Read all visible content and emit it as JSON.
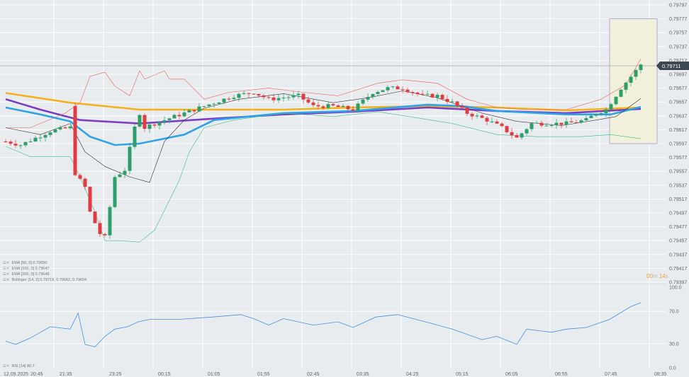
{
  "legend": [
    {
      "label": "EMA [50, 0] 0.79650"
    },
    {
      "label": "EMA [100, 0] 0.79647"
    },
    {
      "label": "EMA [200, 0] 0.79649"
    },
    {
      "label": "Bollinger [14, 2] 0.79719, 0.79662, 0.79604"
    }
  ],
  "rsi_legend": "RSI [14] 80.7",
  "current_price": "0.79711",
  "timer": {
    "min": "00",
    "min_unit": "m",
    "sec": "14",
    "sec_unit": "s"
  },
  "colors": {
    "up": "#2e9e6a",
    "down": "#e23b3f",
    "ema50": "#2ea3e6",
    "ema100": "#7b3fc4",
    "ema200": "#f2b31c",
    "bb_upper": "#e8625f",
    "bb_mid": "#333333",
    "bb_lower": "#3fbf85",
    "rsi": "#4a90e2",
    "highlight": "#f0f0dc"
  },
  "chart_data": {
    "type": "candlestick",
    "price_axis": {
      "ticks": [
        "0.79797",
        "0.79777",
        "0.79757",
        "0.79737",
        "0.79717",
        "0.79697",
        "0.79677",
        "0.79657",
        "0.79637",
        "0.79617",
        "0.79597",
        "0.79577",
        "0.79557",
        "0.79537",
        "0.79517",
        "0.79497",
        "0.79477",
        "0.79457",
        "0.79437",
        "0.79417",
        "0.79397"
      ],
      "range": [
        0.79397,
        0.79797
      ]
    },
    "time_axis": [
      "12.09.2025",
      "20:45",
      "21:35",
      "23:25",
      "00:15",
      "01:05",
      "01:55",
      "02:45",
      "03:35",
      "04:25",
      "05:15",
      "06:05",
      "06:55",
      "07:45",
      "08:35"
    ],
    "candle_count": 129,
    "close_keypoints": [
      [
        0,
        0.796
      ],
      [
        3,
        0.79595
      ],
      [
        6,
        0.79605
      ],
      [
        9,
        0.79615
      ],
      [
        13,
        0.7962
      ],
      [
        14,
        0.79554
      ],
      [
        16,
        0.79534
      ],
      [
        17,
        0.79498
      ],
      [
        19,
        0.79467
      ],
      [
        20,
        0.79462
      ],
      [
        22,
        0.79549
      ],
      [
        24,
        0.79559
      ],
      [
        26,
        0.7962
      ],
      [
        27,
        0.79641
      ],
      [
        28,
        0.7962
      ],
      [
        30,
        0.79626
      ],
      [
        36,
        0.79641
      ],
      [
        40,
        0.79651
      ],
      [
        46,
        0.79666
      ],
      [
        50,
        0.79671
      ],
      [
        53,
        0.79661
      ],
      [
        59,
        0.79666
      ],
      [
        62,
        0.79651
      ],
      [
        66,
        0.79651
      ],
      [
        70,
        0.79646
      ],
      [
        74,
        0.79671
      ],
      [
        77,
        0.79677
      ],
      [
        80,
        0.79677
      ],
      [
        84,
        0.79666
      ],
      [
        87,
        0.79666
      ],
      [
        90,
        0.79656
      ],
      [
        93,
        0.79641
      ],
      [
        97,
        0.79631
      ],
      [
        100,
        0.7962
      ],
      [
        103,
        0.79605
      ],
      [
        106,
        0.79626
      ],
      [
        109,
        0.79626
      ],
      [
        113,
        0.79626
      ],
      [
        117,
        0.79631
      ],
      [
        119,
        0.79641
      ],
      [
        121,
        0.79646
      ],
      [
        124,
        0.79677
      ],
      [
        127,
        0.79702
      ],
      [
        128,
        0.79711
      ]
    ],
    "series": [
      {
        "name": "EMA 200",
        "color_key": "ema200",
        "points": [
          [
            0,
            0.7967
          ],
          [
            13,
            0.79656
          ],
          [
            27,
            0.79646
          ],
          [
            56,
            0.79646
          ],
          [
            70,
            0.79649
          ],
          [
            85,
            0.79651
          ],
          [
            99,
            0.79649
          ],
          [
            113,
            0.79645
          ],
          [
            128,
            0.79649
          ]
        ]
      },
      {
        "name": "EMA 100",
        "color_key": "ema100",
        "points": [
          [
            0,
            0.79661
          ],
          [
            7,
            0.79646
          ],
          [
            15,
            0.79631
          ],
          [
            27,
            0.79626
          ],
          [
            42,
            0.79633
          ],
          [
            56,
            0.79639
          ],
          [
            70,
            0.79643
          ],
          [
            85,
            0.79649
          ],
          [
            99,
            0.79644
          ],
          [
            113,
            0.79641
          ],
          [
            128,
            0.79647
          ]
        ]
      },
      {
        "name": "EMA 50",
        "color_key": "ema50",
        "points": [
          [
            0,
            0.79649
          ],
          [
            7,
            0.79639
          ],
          [
            13,
            0.79629
          ],
          [
            17,
            0.79607
          ],
          [
            22,
            0.79595
          ],
          [
            27,
            0.79597
          ],
          [
            36,
            0.7961
          ],
          [
            42,
            0.79631
          ],
          [
            56,
            0.79641
          ],
          [
            70,
            0.79644
          ],
          [
            85,
            0.79653
          ],
          [
            92,
            0.79651
          ],
          [
            99,
            0.79644
          ],
          [
            113,
            0.79639
          ],
          [
            122,
            0.79639
          ],
          [
            128,
            0.7965
          ]
        ]
      },
      {
        "name": "Bollinger upper",
        "color_key": "bb_upper",
        "points": [
          [
            0,
            0.7962
          ],
          [
            5,
            0.7962
          ],
          [
            12,
            0.79641
          ],
          [
            15,
            0.79656
          ],
          [
            17,
            0.79694
          ],
          [
            20,
            0.797
          ],
          [
            22,
            0.7968
          ],
          [
            25,
            0.79666
          ],
          [
            27,
            0.79702
          ],
          [
            28,
            0.7969
          ],
          [
            32,
            0.79702
          ],
          [
            33,
            0.7969
          ],
          [
            36,
            0.7969
          ],
          [
            40,
            0.79661
          ],
          [
            45,
            0.79671
          ],
          [
            53,
            0.79677
          ],
          [
            60,
            0.79671
          ],
          [
            67,
            0.79666
          ],
          [
            75,
            0.79684
          ],
          [
            80,
            0.79689
          ],
          [
            87,
            0.79684
          ],
          [
            93,
            0.79661
          ],
          [
            99,
            0.79649
          ],
          [
            105,
            0.79646
          ],
          [
            113,
            0.79646
          ],
          [
            120,
            0.79661
          ],
          [
            125,
            0.79682
          ],
          [
            128,
            0.79719
          ]
        ]
      },
      {
        "name": "Bollinger middle",
        "color_key": "bb_mid",
        "points": [
          [
            0,
            0.7962
          ],
          [
            7,
            0.7961
          ],
          [
            13,
            0.79626
          ],
          [
            16,
            0.79585
          ],
          [
            20,
            0.79564
          ],
          [
            25,
            0.79549
          ],
          [
            29,
            0.79541
          ],
          [
            32,
            0.796
          ],
          [
            36,
            0.79631
          ],
          [
            40,
            0.79648
          ],
          [
            47,
            0.79661
          ],
          [
            56,
            0.79669
          ],
          [
            66,
            0.79656
          ],
          [
            73,
            0.79663
          ],
          [
            80,
            0.79673
          ],
          [
            87,
            0.79663
          ],
          [
            96,
            0.79641
          ],
          [
            103,
            0.79629
          ],
          [
            112,
            0.79623
          ],
          [
            119,
            0.79631
          ],
          [
            123,
            0.79636
          ],
          [
            128,
            0.79662
          ]
        ]
      },
      {
        "name": "Bollinger lower",
        "color_key": "bb_lower",
        "points": [
          [
            0,
            0.79593
          ],
          [
            5,
            0.79578
          ],
          [
            13,
            0.79578
          ],
          [
            15,
            0.79549
          ],
          [
            18,
            0.79498
          ],
          [
            20,
            0.79457
          ],
          [
            23,
            0.79457
          ],
          [
            27,
            0.79455
          ],
          [
            30,
            0.79472
          ],
          [
            35,
            0.79544
          ],
          [
            37,
            0.79585
          ],
          [
            40,
            0.7962
          ],
          [
            46,
            0.79631
          ],
          [
            56,
            0.79641
          ],
          [
            66,
            0.79636
          ],
          [
            75,
            0.79643
          ],
          [
            83,
            0.79634
          ],
          [
            90,
            0.79626
          ],
          [
            99,
            0.7961
          ],
          [
            107,
            0.79607
          ],
          [
            116,
            0.79607
          ],
          [
            122,
            0.7961
          ],
          [
            128,
            0.79604
          ]
        ]
      }
    ],
    "highlight_range": {
      "start_index": 122,
      "end_index": 131,
      "price_range": [
        0.79597,
        0.79777
      ]
    },
    "rsi": {
      "axis_ticks": [
        "100.0",
        "70.0",
        "30.0",
        "0.0"
      ],
      "range": [
        0,
        100
      ],
      "points": [
        [
          0,
          33
        ],
        [
          2,
          29
        ],
        [
          5,
          37
        ],
        [
          9,
          51
        ],
        [
          13,
          48
        ],
        [
          14.6,
          68
        ],
        [
          16,
          29
        ],
        [
          18,
          26
        ],
        [
          20,
          39
        ],
        [
          22,
          48
        ],
        [
          24.6,
          51
        ],
        [
          26.7,
          57
        ],
        [
          29,
          60
        ],
        [
          34.6,
          60
        ],
        [
          41.7,
          63
        ],
        [
          47.4,
          66
        ],
        [
          50,
          61
        ],
        [
          53,
          53
        ],
        [
          56,
          61
        ],
        [
          62,
          53
        ],
        [
          67,
          57
        ],
        [
          70,
          50
        ],
        [
          74.6,
          63
        ],
        [
          79,
          66
        ],
        [
          84.6,
          57
        ],
        [
          90,
          48
        ],
        [
          96,
          35
        ],
        [
          99,
          39
        ],
        [
          103,
          29
        ],
        [
          105,
          48
        ],
        [
          110,
          44
        ],
        [
          113,
          48
        ],
        [
          117,
          50
        ],
        [
          121.7,
          60
        ],
        [
          126,
          76
        ],
        [
          128,
          80.7
        ]
      ]
    }
  }
}
